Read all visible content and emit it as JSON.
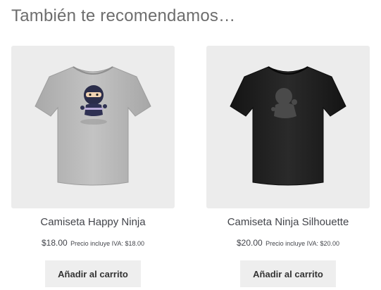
{
  "section": {
    "title": "También te recomendamos…"
  },
  "products": [
    {
      "name": "Camiseta Happy Ninja",
      "price": "$18.00",
      "tax_note": "Precio incluye IVA: $18.00",
      "add_to_cart_label": "Añadir al carrito",
      "image_icon": "happy-ninja-tshirt-image",
      "shirt_color": "#b9b9b9"
    },
    {
      "name": "Camiseta Ninja Silhouette",
      "price": "$20.00",
      "tax_note": "Precio incluye IVA: $20.00",
      "add_to_cart_label": "Añadir al carrito",
      "image_icon": "ninja-silhouette-tshirt-image",
      "shirt_color": "#1f1f1f"
    }
  ],
  "colors": {
    "card_background": "#ececec",
    "button_background": "#eeeeee",
    "title_text": "#6d6d6d",
    "body_text": "#43454b"
  }
}
